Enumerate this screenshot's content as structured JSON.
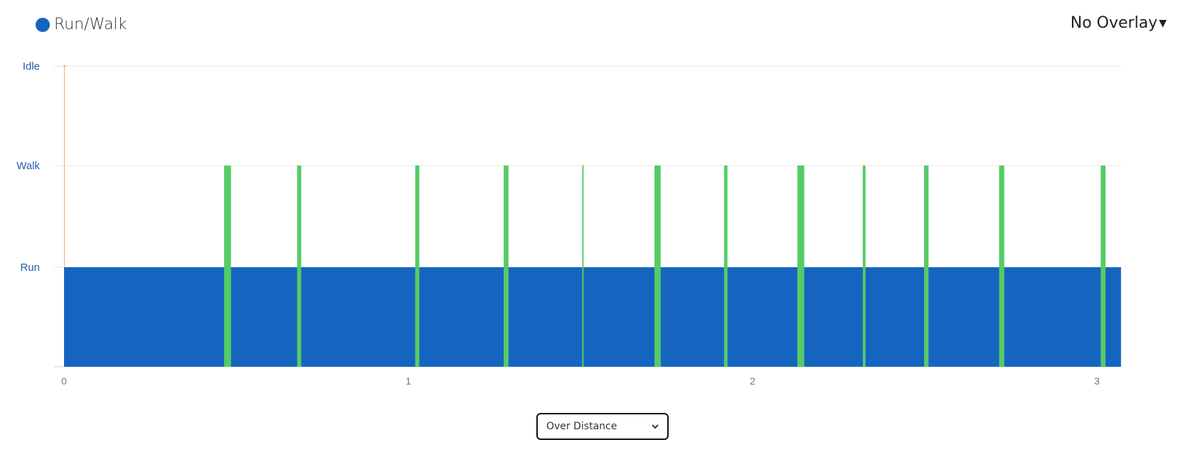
{
  "legend": {
    "label": "Run/Walk",
    "color": "#1565c0"
  },
  "overlay": {
    "label": "No Overlay",
    "icon": "caret-down-icon"
  },
  "mode_select": {
    "value": "Over Distance",
    "icon": "chevron-down-icon"
  },
  "chart_data": {
    "type": "area",
    "title": "",
    "xlabel": "",
    "ylabel": "",
    "xlim": [
      0,
      3.07
    ],
    "x_ticks": [
      "0",
      "1",
      "2",
      "3"
    ],
    "y_ticks": [
      "Idle",
      "Walk",
      "Run"
    ],
    "grid": "horizontal",
    "series": [
      {
        "name": "Run/Walk",
        "color": "#1565c0",
        "state": "Run",
        "x": [
          0,
          3.07
        ]
      }
    ],
    "walk_segments": {
      "color": "#55cc66",
      "state": "Walk",
      "intervals": [
        [
          0.465,
          0.485
        ],
        [
          0.677,
          0.689
        ],
        [
          1.02,
          1.032
        ],
        [
          1.277,
          1.291
        ],
        [
          1.505,
          1.509
        ],
        [
          1.715,
          1.733
        ],
        [
          1.917,
          1.927
        ],
        [
          2.13,
          2.15
        ],
        [
          2.32,
          2.328
        ],
        [
          2.498,
          2.511
        ],
        [
          2.716,
          2.731
        ],
        [
          3.011,
          3.025
        ]
      ]
    },
    "idle_marker": {
      "x": 0,
      "color": "#f4b183"
    }
  }
}
